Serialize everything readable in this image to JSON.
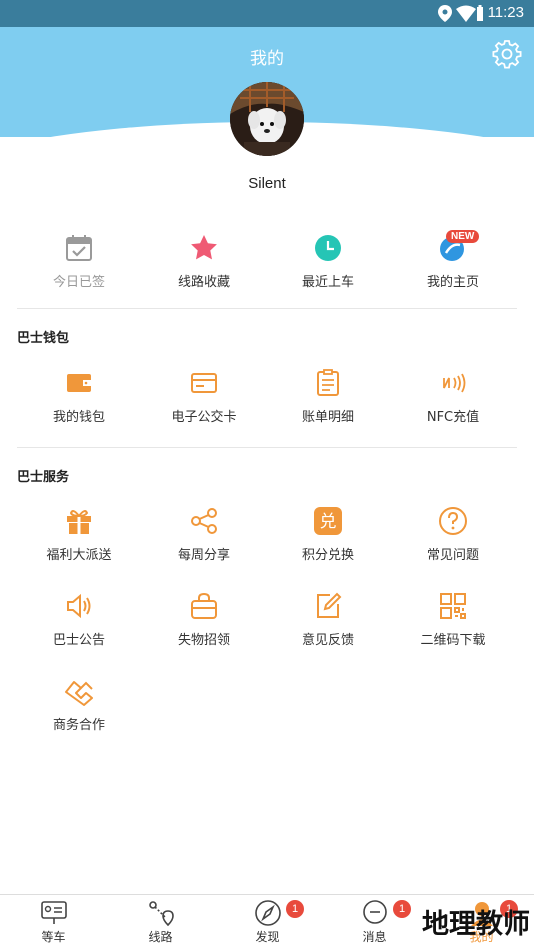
{
  "status_bar": {
    "time": "11:23"
  },
  "header": {
    "title": "我的"
  },
  "profile": {
    "username": "Silent"
  },
  "quick_actions": [
    {
      "label": "今日已签",
      "icon": "calendar-check-icon"
    },
    {
      "label": "线路收藏",
      "icon": "star-icon"
    },
    {
      "label": "最近上车",
      "icon": "clock-icon"
    },
    {
      "label": "我的主页",
      "icon": "homepage-icon",
      "badge": "NEW"
    }
  ],
  "wallet": {
    "title": "巴士钱包",
    "items": [
      {
        "label": "我的钱包",
        "icon": "wallet-icon"
      },
      {
        "label": "电子公交卡",
        "icon": "card-icon"
      },
      {
        "label": "账单明细",
        "icon": "bill-icon"
      },
      {
        "label": "NFC充值",
        "icon": "nfc-icon"
      }
    ]
  },
  "services": {
    "title": "巴士服务",
    "items": [
      {
        "label": "福利大派送",
        "icon": "gift-icon"
      },
      {
        "label": "每周分享",
        "icon": "share-icon"
      },
      {
        "label": "积分兑换",
        "icon": "redeem-icon",
        "glyph": "兑"
      },
      {
        "label": "常见问题",
        "icon": "question-icon"
      },
      {
        "label": "巴士公告",
        "icon": "speaker-icon"
      },
      {
        "label": "失物招领",
        "icon": "bag-icon"
      },
      {
        "label": "意见反馈",
        "icon": "edit-icon"
      },
      {
        "label": "二维码下载",
        "icon": "qrcode-icon"
      },
      {
        "label": "商务合作",
        "icon": "handshake-icon"
      }
    ]
  },
  "tabbar": {
    "tabs": [
      {
        "label": "等车",
        "icon": "bus-stop-icon"
      },
      {
        "label": "线路",
        "icon": "route-icon"
      },
      {
        "label": "发现",
        "icon": "compass-icon",
        "badge": "1"
      },
      {
        "label": "消息",
        "icon": "message-icon",
        "badge": "1"
      },
      {
        "label": "我的",
        "icon": "profile-icon",
        "badge": "1"
      }
    ]
  },
  "watermark": "地理教师",
  "colors": {
    "header": "#7fcdf0",
    "accent": "#f0973a",
    "badge": "#e84a3c"
  }
}
